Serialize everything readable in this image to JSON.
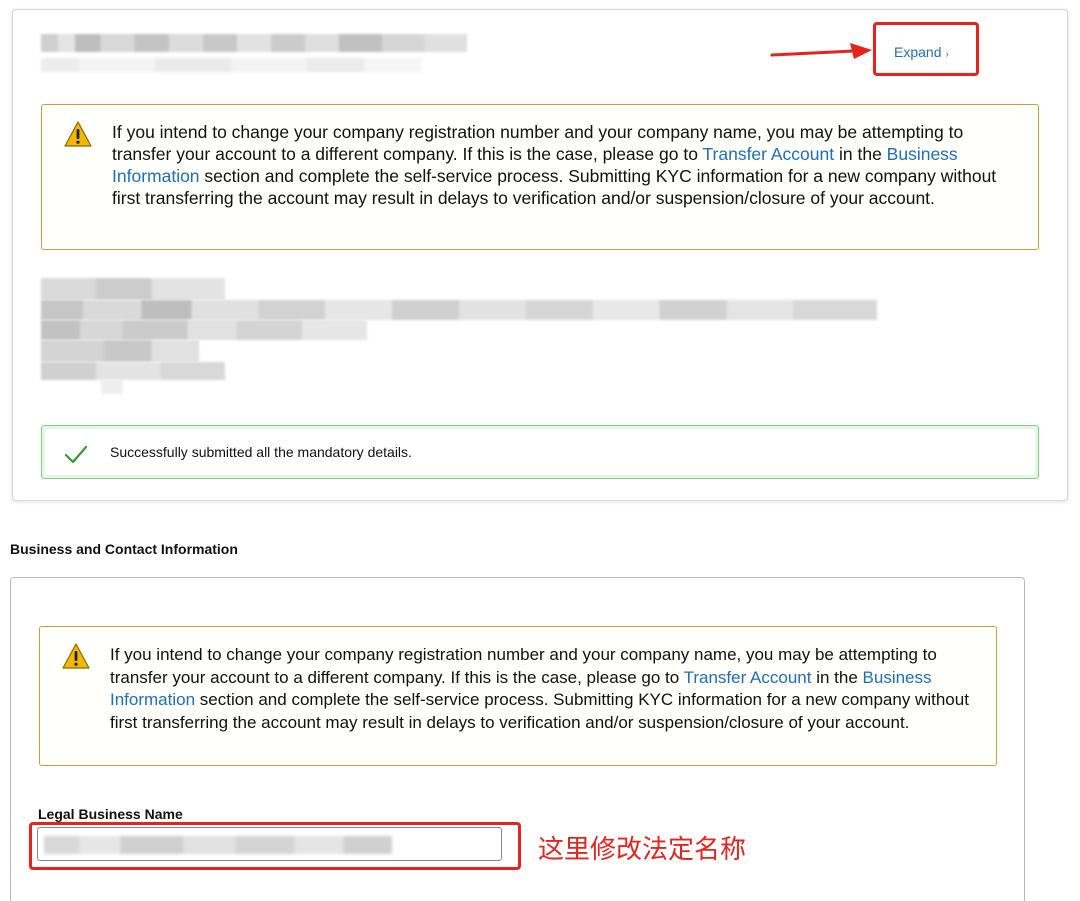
{
  "top_card": {
    "expand_label": "Expand",
    "expand_chevron": "›",
    "alert": {
      "text_1": "If you intend to change your company registration number and your company name, you may be attempting to transfer your account to a different company. If this is the case, please go to ",
      "link_transfer": "Transfer Account",
      "text_2": " in the ",
      "link_business": "Business Information",
      "text_3": " section and complete the self-service process. Submitting KYC information for a new company without first transferring the account may result in delays to verification and/or suspension/closure of your account."
    },
    "success_message": "Successfully submitted all the mandatory details."
  },
  "section": {
    "title": "Business and Contact Information"
  },
  "bottom_card": {
    "alert": {
      "text_1": "If you intend to change your company registration number and your company name, you may be attempting to transfer your account to a different company. If this is the case, please go to ",
      "link_transfer": "Transfer Account",
      "text_2": " in the ",
      "link_business": "Business Information",
      "text_3": " section and complete the self-service process. Submitting KYC information for a new company without first transferring the account may result in delays to verification and/or suspension/closure of your account."
    },
    "legal_name_label": "Legal Business Name",
    "annotation": "这里修改法定名称"
  },
  "colors": {
    "link": "#1d6fb8",
    "annotation_red": "#e8231c",
    "warning_border": "#c9a13a",
    "success_border": "#7fcf7f",
    "check_green": "#2e9e3a",
    "warning_yellow": "#f5b800"
  },
  "icons": [
    "warning-icon",
    "check-icon",
    "chevron-right-icon",
    "arrow-annotation"
  ]
}
